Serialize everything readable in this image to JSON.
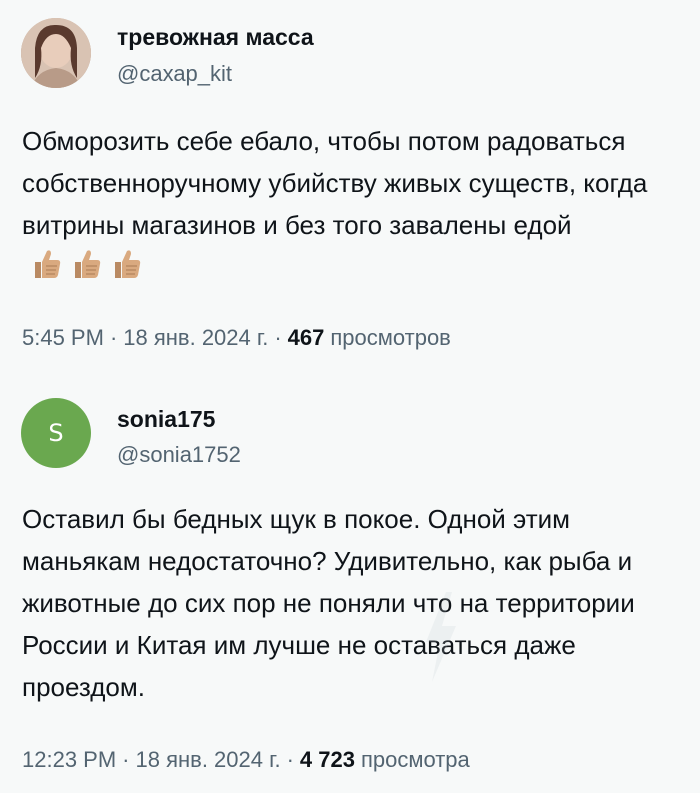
{
  "tweets": [
    {
      "avatar": {
        "type": "photo"
      },
      "display_name": "тревожная масса",
      "handle": "@сахар_kit",
      "text": "Обморозить себе ебало, чтобы потом радоваться собственноручному убийству живых существ, когда витрины магазинов и без того завалены едой",
      "emoji": [
        "thumbs-up-icon",
        "thumbs-up-icon",
        "thumbs-up-icon"
      ],
      "time": "5:45 PM",
      "date": "18 янв. 2024 г.",
      "views_count": "467",
      "views_label": "просмотров",
      "separator": "·"
    },
    {
      "avatar": {
        "type": "initial",
        "letter": "S",
        "color": "#6aa84f"
      },
      "display_name": "sonia175",
      "handle": "@sonia1752",
      "text": "Оставил бы бедных щук в покое. Одной этим маньякам недостаточно? Удивительно, как рыба и животные до сих пор не поняли что на территории России и Китая им лучше не оставаться даже проездом.",
      "time": "12:23 PM",
      "date": "18 янв. 2024 г.",
      "views_count": "4 723",
      "views_label": "просмотра",
      "separator": "·"
    }
  ],
  "colors": {
    "background": "#f7f9f9",
    "text": "#0f1419",
    "secondary": "#536471",
    "emoji_skin": "#d9a97f"
  }
}
